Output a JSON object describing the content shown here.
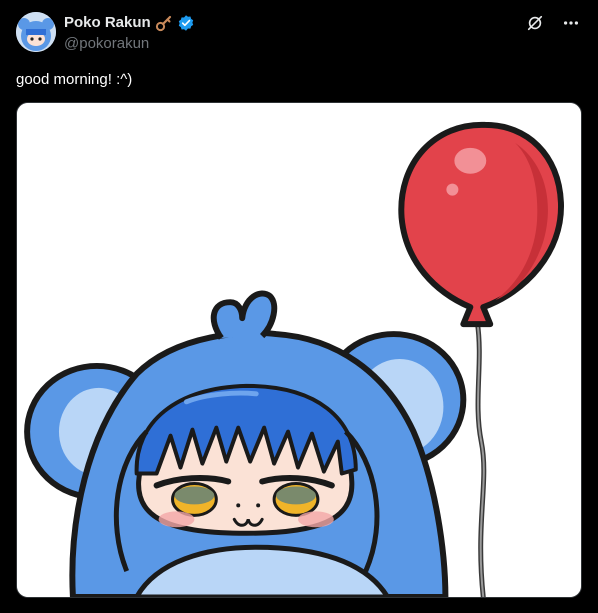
{
  "author": {
    "display_name": "Poko Rakun",
    "handle": "@pokorakun",
    "avatar": "avatar-image",
    "badges": [
      "key-icon",
      "verified-badge-icon"
    ]
  },
  "header_actions": [
    "grok-icon",
    "more-icon"
  ],
  "tweet": {
    "text": "good morning! :^)"
  },
  "media": {
    "kind": "illustration",
    "icon": "image",
    "colors": {
      "background": "#ffffff",
      "character_blue": "#5a98e6",
      "ear_inner": "#b9d6f7",
      "hair_blue": "#2f6fd6",
      "balloon_red": "#e2434b",
      "skin": "#fbe2d6"
    }
  },
  "colors": {
    "background": "#000000",
    "text": "#e7e9ea",
    "secondary_text": "#71767b",
    "verified": "#1d9bf0",
    "key": "#c98a5b"
  }
}
